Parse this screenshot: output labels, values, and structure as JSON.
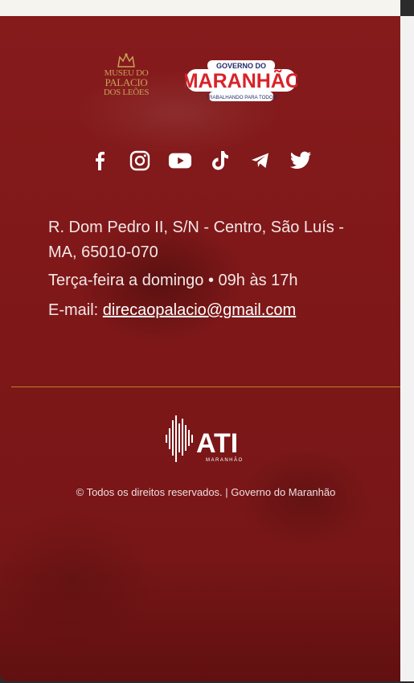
{
  "logos": {
    "museu_lines": [
      "MUSEU DO",
      "PALACIO",
      "DOS LEÕES"
    ],
    "gov_top": "GOVERNO DO",
    "gov_name": "MARANHÃO",
    "gov_slogan": "TRABALHANDO PARA TODOS"
  },
  "social": [
    {
      "name": "facebook-icon"
    },
    {
      "name": "instagram-icon"
    },
    {
      "name": "youtube-icon"
    },
    {
      "name": "tiktok-icon"
    },
    {
      "name": "telegram-icon"
    },
    {
      "name": "twitter-icon"
    }
  ],
  "contact": {
    "address": "R. Dom Pedro II, S/N - Centro, São Luís - MA, 65010-070",
    "hours": "Terça-feira a domingo • 09h às 17h",
    "email_label": "E-mail: ",
    "email": "direcaopalacio@gmail.com"
  },
  "ati": {
    "title": "ATI",
    "subtitle": "MARANHÃO"
  },
  "copyright": "© Todos os direitos reservados. | Governo do Maranhão",
  "colors": {
    "footer_bg": "#801819",
    "divider": "#b8842e",
    "gold": "#c9a05a"
  }
}
